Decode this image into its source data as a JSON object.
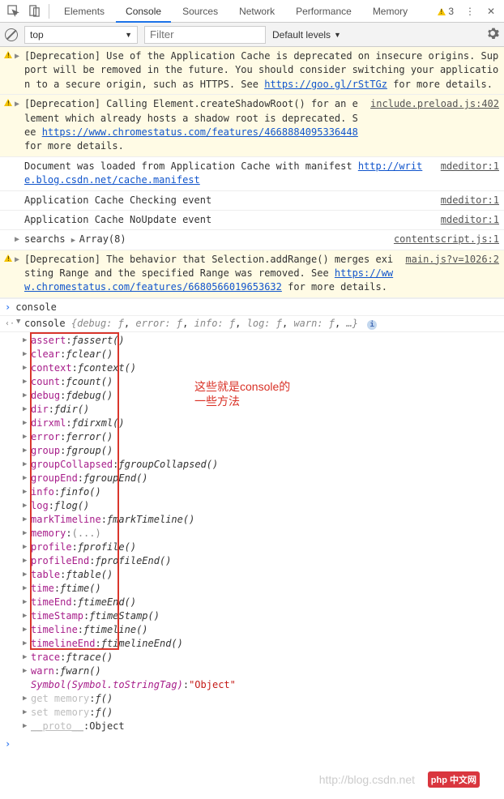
{
  "tabs": [
    "Elements",
    "Console",
    "Sources",
    "Network",
    "Performance",
    "Memory"
  ],
  "activeTab": "Console",
  "warnCount": "3",
  "toolbar": {
    "context": "top",
    "filterPlaceholder": "Filter",
    "levels": "Default levels"
  },
  "messages": [
    {
      "type": "warn",
      "expand": true,
      "text_a": "[Deprecation] Use of the Application Cache is deprecated on insecure origins. Support will be removed in the future. You should consider switching your application to a secure origin, such as HTTPS. See ",
      "link": "https://goo.gl/rStTGz",
      "text_b": " for more details.",
      "src": ""
    },
    {
      "type": "warn",
      "expand": true,
      "text_a": "[Deprecation] Calling Element.createShadowRoot() for an element which already hosts a shadow root is deprecated. See ",
      "link": "https://www.chromestatus.com/features/4668884095336448",
      "text_b": " for more details.",
      "src": "include.preload.js:402"
    },
    {
      "type": "info",
      "text_a": "Document was loaded from Application Cache with manifest ",
      "link": "http://write.blog.csdn.net/cache.manifest",
      "text_b": "",
      "src": "mdeditor:1"
    },
    {
      "type": "info",
      "text_a": "Application Cache Checking event",
      "src": "mdeditor:1"
    },
    {
      "type": "info",
      "text_a": "Application Cache NoUpdate event",
      "src": "mdeditor:1"
    },
    {
      "type": "eval",
      "text_a": "searchs",
      "preview": "Array(8)",
      "src": "contentscript.js:1"
    },
    {
      "type": "warn",
      "expand": true,
      "text_a": "[Deprecation] The behavior that Selection.addRange() merges existing Range and the specified Range was removed. See ",
      "link": "https://www.chromestatus.com/features/6680566019653632",
      "text_b": " for more details.",
      "src": "main.js?v=1026:2"
    }
  ],
  "input": "console",
  "result": {
    "header": "console",
    "summary": [
      "debug: ƒ",
      "error: ƒ",
      "info: ƒ",
      "log: ƒ",
      "warn: ƒ",
      "…"
    ],
    "props": [
      {
        "name": "assert",
        "fn": "assert()"
      },
      {
        "name": "clear",
        "fn": "clear()"
      },
      {
        "name": "context",
        "fn": "context()"
      },
      {
        "name": "count",
        "fn": "count()"
      },
      {
        "name": "debug",
        "fn": "debug()"
      },
      {
        "name": "dir",
        "fn": "dir()"
      },
      {
        "name": "dirxml",
        "fn": "dirxml()"
      },
      {
        "name": "error",
        "fn": "error()"
      },
      {
        "name": "group",
        "fn": "group()"
      },
      {
        "name": "groupCollapsed",
        "fn": "groupCollapsed()"
      },
      {
        "name": "groupEnd",
        "fn": "groupEnd()"
      },
      {
        "name": "info",
        "fn": "info()"
      },
      {
        "name": "log",
        "fn": "log()"
      },
      {
        "name": "markTimeline",
        "fn": "markTimeline()"
      },
      {
        "name": "memory",
        "literal": "(...)"
      },
      {
        "name": "profile",
        "fn": "profile()"
      },
      {
        "name": "profileEnd",
        "fn": "profileEnd()"
      },
      {
        "name": "table",
        "fn": "table()"
      },
      {
        "name": "time",
        "fn": "time()"
      },
      {
        "name": "timeEnd",
        "fn": "timeEnd()"
      },
      {
        "name": "timeStamp",
        "fn": "timeStamp()"
      },
      {
        "name": "timeline",
        "fn": "timeline()"
      },
      {
        "name": "timelineEnd",
        "fn": "timelineEnd()"
      },
      {
        "name": "trace",
        "fn": "trace()"
      },
      {
        "name": "warn",
        "fn": "warn()"
      }
    ],
    "symbol": {
      "key": "Symbol(Symbol.toStringTag)",
      "val": "\"Object\""
    },
    "accessors": [
      {
        "name": "get memory",
        "fn": "()"
      },
      {
        "name": "set memory",
        "fn": "()"
      }
    ],
    "proto": {
      "name": "__proto__",
      "val": "Object"
    }
  },
  "annotation": {
    "line1": "这些就是console的",
    "line2": "一些方法"
  },
  "watermark": "http://blog.csdn.net",
  "phpbadge": "php 中文网"
}
